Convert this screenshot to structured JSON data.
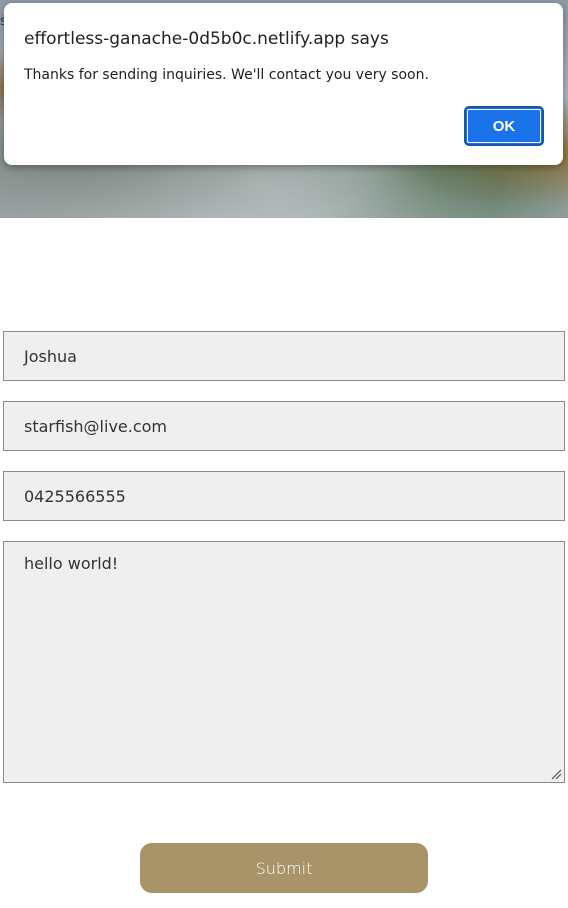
{
  "edge_char": "s",
  "alert": {
    "title": "effortless-ganache-0d5b0c.netlify.app says",
    "message": "Thanks for sending inquiries. We'll contact you very soon.",
    "ok_label": "OK",
    "accent_color": "#1a73e8"
  },
  "form": {
    "name_value": "Joshua",
    "email_value": "starfish@live.com",
    "phone_value": "0425566555",
    "message_value": "hello world!",
    "submit_label": "Submit",
    "submit_color": "#a89468"
  }
}
